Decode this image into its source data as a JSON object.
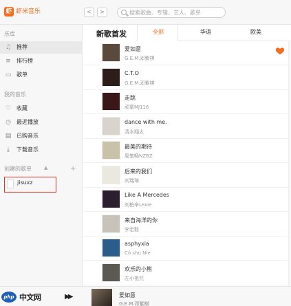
{
  "app": {
    "logo_char": "虾",
    "name": "虾米音乐"
  },
  "nav": {
    "back": "<",
    "forward": ">"
  },
  "search": {
    "placeholder": "搜索歌曲、专辑、艺人、歌单"
  },
  "sidebar": {
    "library_title": "乐库",
    "library_items": [
      {
        "label": "推荐",
        "icon": "music-note-icon",
        "active": true
      },
      {
        "label": "排行榜",
        "icon": "chart-icon",
        "active": false
      },
      {
        "label": "歌单",
        "icon": "playlist-icon",
        "active": false
      }
    ],
    "my_music_title": "我的音乐",
    "my_music_items": [
      {
        "label": "收藏",
        "icon": "heart-icon"
      },
      {
        "label": "最近播放",
        "icon": "clock-icon"
      },
      {
        "label": "已购音乐",
        "icon": "purchased-icon"
      },
      {
        "label": "下载音乐",
        "icon": "download-icon"
      }
    ],
    "created_title": "创建的歌单",
    "add_symbol": "+",
    "playlist_name": "jisuxz"
  },
  "main": {
    "title": "新歌首发",
    "tabs": [
      {
        "label": "全部",
        "active": true
      },
      {
        "label": "华语",
        "active": false
      },
      {
        "label": "欧美",
        "active": false
      }
    ],
    "songs": [
      {
        "title": "爱如意",
        "artist": "G.E.M.邓紫棋",
        "cover_color": "#5a4a3e",
        "liked": true
      },
      {
        "title": "C.T.O",
        "artist": "G.E.M.邓紫棋",
        "cover_color": "#2c1d1a",
        "liked": false
      },
      {
        "title": "走跳",
        "artist": "顽童MJ116",
        "cover_color": "#3a1718",
        "liked": false
      },
      {
        "title": "dance with me.",
        "artist": "清水翔太",
        "cover_color": "#d8d3cc",
        "liked": false
      },
      {
        "title": "最美的期待",
        "artist": "周笔畅NZBZ",
        "cover_color": "#c9c2a8",
        "liked": false
      },
      {
        "title": "后来的我们",
        "artist": "刘瑞琦",
        "cover_color": "#e9e9e0",
        "liked": false
      },
      {
        "title": "Like A Mercedes",
        "artist": "刘柏辛Lexie",
        "cover_color": "#2b1e2e",
        "liked": false
      },
      {
        "title": "来自海洋的你",
        "artist": "李宏毅",
        "cover_color": "#c7c3bb",
        "liked": false
      },
      {
        "title": "asphyxia",
        "artist": "Cö shu Nie",
        "cover_color": "#2b5d8a",
        "liked": false
      },
      {
        "title": "欢乐的小熊",
        "artist": "左小祖咒",
        "cover_color": "#5a5a52",
        "liked": false
      }
    ]
  },
  "player": {
    "watermark_logo": "php",
    "watermark_text": "中文网",
    "now_playing_title": "爱如意",
    "now_playing_artist": "G.E.M.邓紫棋"
  }
}
